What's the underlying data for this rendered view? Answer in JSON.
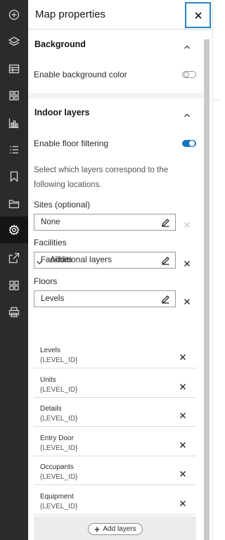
{
  "panel": {
    "title": "Map properties"
  },
  "action_bar": {
    "icons": [
      "add-icon",
      "layers-icon",
      "table-icon",
      "grid-icon",
      "chart-icon",
      "list-icon",
      "bookmark-icon",
      "folder-icon",
      "settings-icon",
      "share-icon",
      "widgets-icon",
      "print-icon"
    ],
    "active": "settings-icon"
  },
  "background_section": {
    "title": "Background",
    "enable_bg_label": "Enable background color",
    "enable_bg_on": false
  },
  "indoor_section": {
    "title": "Indoor layers",
    "floor_filter_label": "Enable floor filtering",
    "floor_filter_on": true,
    "description": "Select which layers correspond to the following locations.",
    "sites_label": "Sites (optional)",
    "sites_value": "None",
    "facilities_label": "Facilities",
    "facilities_value": "Facilities",
    "floors_label": "Floors",
    "floors_value": "Levels"
  },
  "additional_layers": {
    "title": "Additional layers",
    "items": [
      {
        "name": "Levels",
        "field": "{LEVEL_ID}"
      },
      {
        "name": "Units",
        "field": "{LEVEL_ID}"
      },
      {
        "name": "Details",
        "field": "{LEVEL_ID}"
      },
      {
        "name": "Entry Door",
        "field": "{LEVEL_ID}"
      },
      {
        "name": "Occupants",
        "field": "{LEVEL_ID}"
      },
      {
        "name": "Equipment",
        "field": "{LEVEL_ID}"
      }
    ],
    "add_label": "Add layers"
  },
  "colors": {
    "accent": "#0f78c0",
    "action_bar": "#2b2b2b",
    "focus_outline": "#2a84c7"
  }
}
